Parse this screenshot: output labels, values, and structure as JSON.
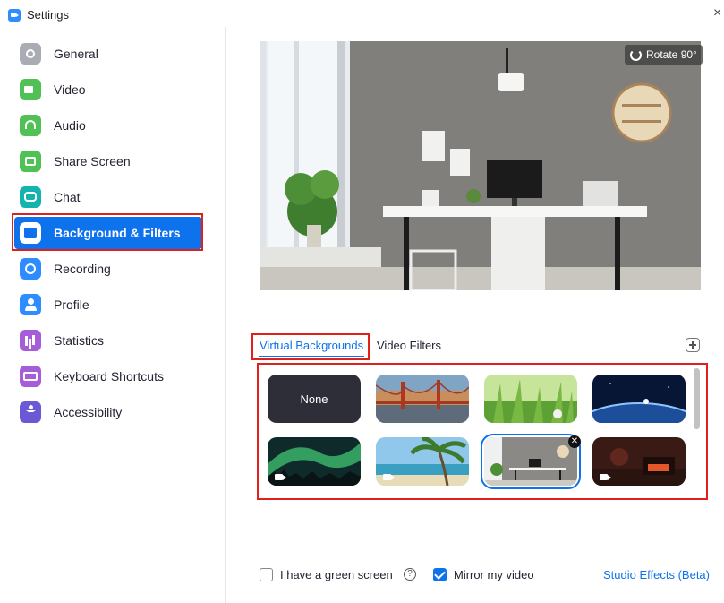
{
  "window": {
    "title": "Settings",
    "close_glyph": "×"
  },
  "sidebar": {
    "items": [
      {
        "label": "General",
        "icon": "gear-icon"
      },
      {
        "label": "Video",
        "icon": "video-camera-icon"
      },
      {
        "label": "Audio",
        "icon": "headphones-icon"
      },
      {
        "label": "Share Screen",
        "icon": "share-screen-icon"
      },
      {
        "label": "Chat",
        "icon": "chat-bubble-icon"
      },
      {
        "label": "Background & Filters",
        "icon": "background-icon",
        "active": true
      },
      {
        "label": "Recording",
        "icon": "record-icon"
      },
      {
        "label": "Profile",
        "icon": "profile-icon"
      },
      {
        "label": "Statistics",
        "icon": "statistics-icon"
      },
      {
        "label": "Keyboard Shortcuts",
        "icon": "keyboard-icon"
      },
      {
        "label": "Accessibility",
        "icon": "accessibility-icon"
      }
    ]
  },
  "preview": {
    "rotate_label": "Rotate 90°"
  },
  "tabs": {
    "virtual_backgrounds": "Virtual Backgrounds",
    "video_filters": "Video Filters",
    "active": "virtual_backgrounds"
  },
  "backgrounds": [
    {
      "label": "None",
      "kind": "none"
    },
    {
      "kind": "image",
      "scene": "golden-gate-bridge"
    },
    {
      "kind": "image",
      "scene": "grass"
    },
    {
      "kind": "image",
      "scene": "earth-from-space"
    },
    {
      "kind": "video",
      "scene": "aurora"
    },
    {
      "kind": "video",
      "scene": "beach-palm"
    },
    {
      "kind": "image",
      "scene": "office-desk",
      "selected": true
    },
    {
      "kind": "video",
      "scene": "fireplace-room"
    }
  ],
  "options": {
    "green_screen_label": "I have a green screen",
    "green_screen_checked": false,
    "help_glyph": "?",
    "mirror_label": "Mirror my video",
    "mirror_checked": true,
    "studio_effects_label": "Studio Effects (Beta)"
  },
  "colors": {
    "accent": "#0e72ed",
    "highlight_red": "#e0211b",
    "none_tile": "#2e2e38"
  }
}
